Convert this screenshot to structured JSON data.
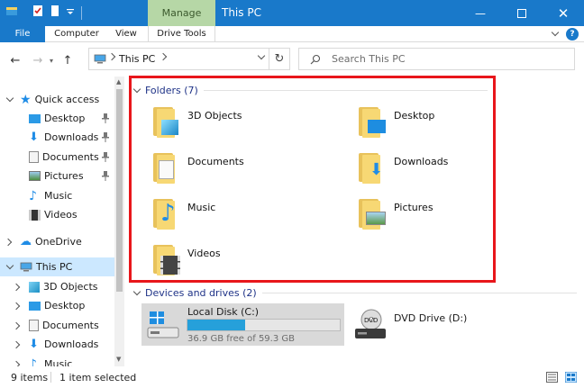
{
  "window": {
    "title": "This PC",
    "context_tab": "Manage"
  },
  "ribbon": {
    "tabs": [
      "File",
      "Computer",
      "View",
      "Drive Tools"
    ]
  },
  "address": {
    "location": "This PC",
    "search_placeholder": "Search This PC"
  },
  "nav": {
    "quick_access": "Quick access",
    "quick_items": [
      "Desktop",
      "Downloads",
      "Documents",
      "Pictures",
      "Music",
      "Videos"
    ],
    "onedrive": "OneDrive",
    "this_pc": "This PC",
    "pc_items": [
      "3D Objects",
      "Desktop",
      "Documents",
      "Downloads",
      "Music"
    ]
  },
  "content": {
    "folders_title": "Folders (7)",
    "folders": [
      "3D Objects",
      "Desktop",
      "Documents",
      "Downloads",
      "Music",
      "Pictures",
      "Videos"
    ],
    "devices_title": "Devices and drives (2)",
    "drives": [
      {
        "name": "Local Disk (C:)",
        "free": "36.9 GB free of 59.3 GB",
        "used_fraction": 0.378
      },
      {
        "name": "DVD Drive (D:)"
      }
    ]
  },
  "status": {
    "items": "9 items",
    "selected": "1 item selected"
  },
  "colors": {
    "accent": "#1979ca",
    "highlight": "#e8161b",
    "manage": "#b6d7a6",
    "bar": "#26a0da"
  }
}
